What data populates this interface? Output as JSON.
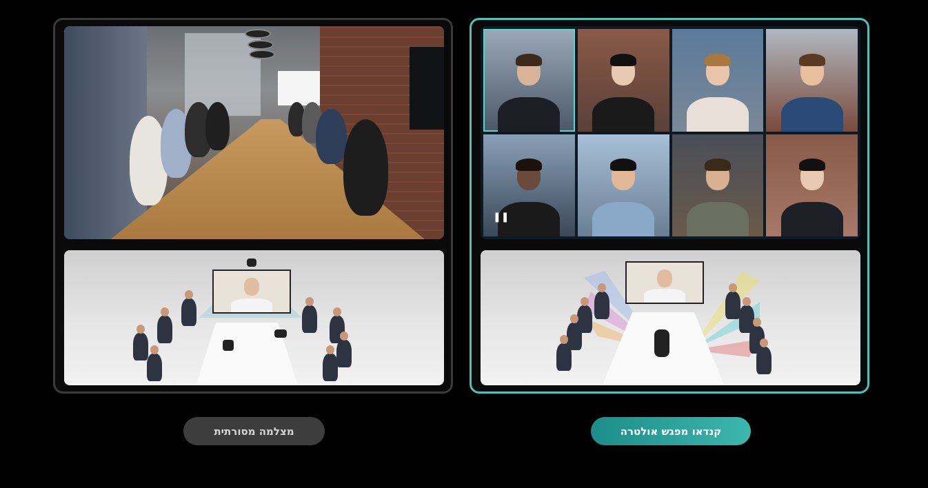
{
  "buttons": {
    "traditional_label": "מצלמה מסורתית",
    "ultra_label": "קנדאו מפגש אולטרה"
  },
  "icons": {
    "pause": "❚❚"
  },
  "colors": {
    "accent": "#4fc0bb",
    "button_active": "#2aa39d",
    "button_inactive": "#3d3d3d",
    "background": "#000000"
  }
}
